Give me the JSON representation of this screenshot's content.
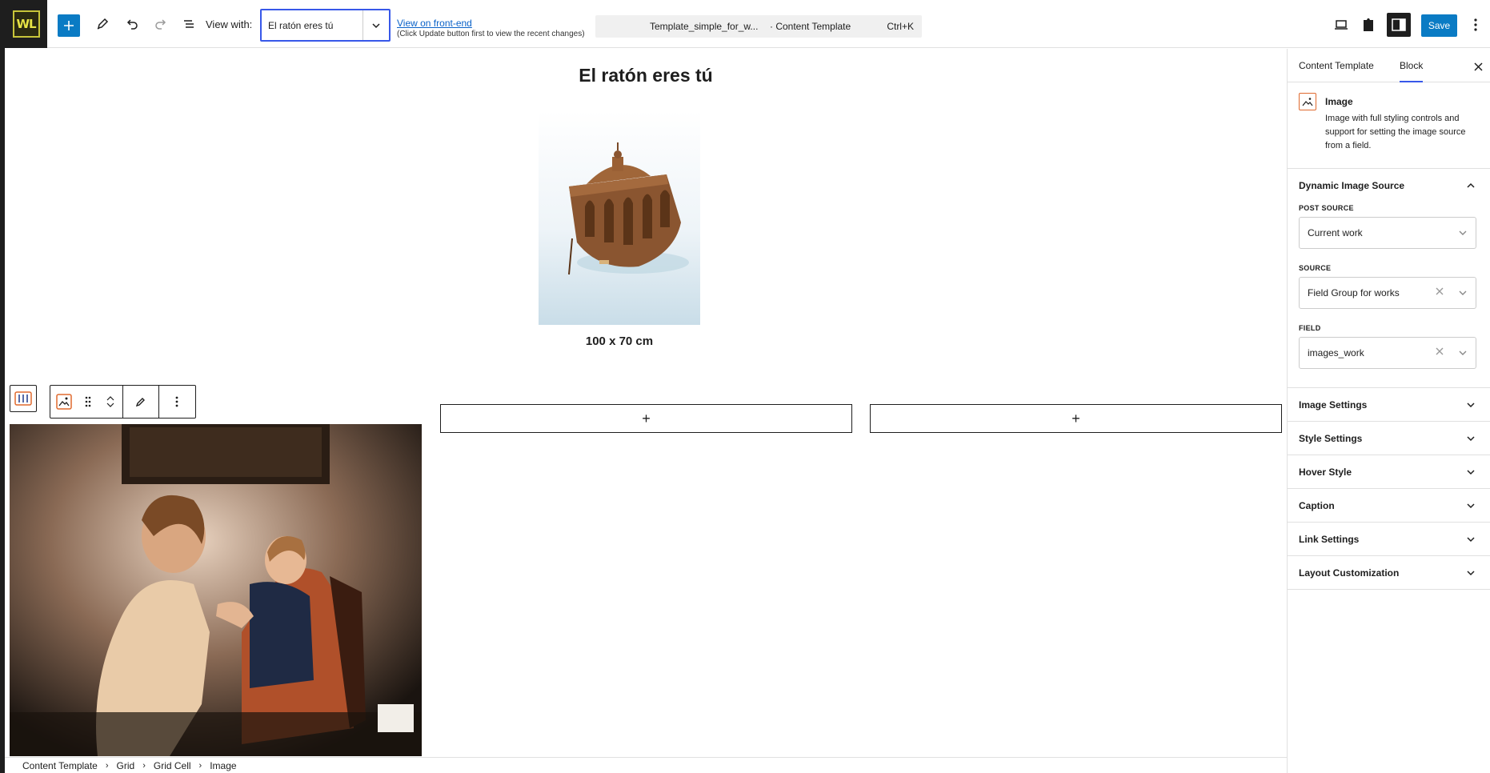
{
  "toolbar": {
    "logo_text": "WL",
    "view_with_label": "View with:",
    "view_with_value": "El ratón eres tú",
    "frontend_link": "View on front-end",
    "frontend_note": "(Click Update button first to view the recent changes)",
    "command_title": "Template_simple_for_w...",
    "command_subtitle": "· Content Template",
    "command_shortcut": "Ctrl+K",
    "save_label": "Save"
  },
  "canvas": {
    "post_title": "El ratón eres tú",
    "artwork_dimensions": "100 x 70 cm",
    "appender_symbol": "+"
  },
  "breadcrumb": [
    "Content Template",
    "Grid",
    "Grid Cell",
    "Image"
  ],
  "sidebar": {
    "tabs": [
      "Content Template",
      "Block"
    ],
    "active_tab": "Block",
    "block": {
      "name": "Image",
      "description": "Image with full styling controls and support for setting the image source from a field."
    },
    "dynamic_source": {
      "title": "Dynamic Image Source",
      "post_source_label": "POST SOURCE",
      "post_source_value": "Current work",
      "source_label": "SOURCE",
      "source_value": "Field Group for works",
      "field_label": "FIELD",
      "field_value": "images_work"
    },
    "panels": [
      "Image Settings",
      "Style Settings",
      "Hover Style",
      "Caption",
      "Link Settings",
      "Layout Customization"
    ]
  },
  "colors": {
    "accent_blue": "#0a7bc4",
    "focus_blue": "#3858e9",
    "block_icon_orange": "#e06a2f",
    "logo_yellow": "#e6e345"
  }
}
